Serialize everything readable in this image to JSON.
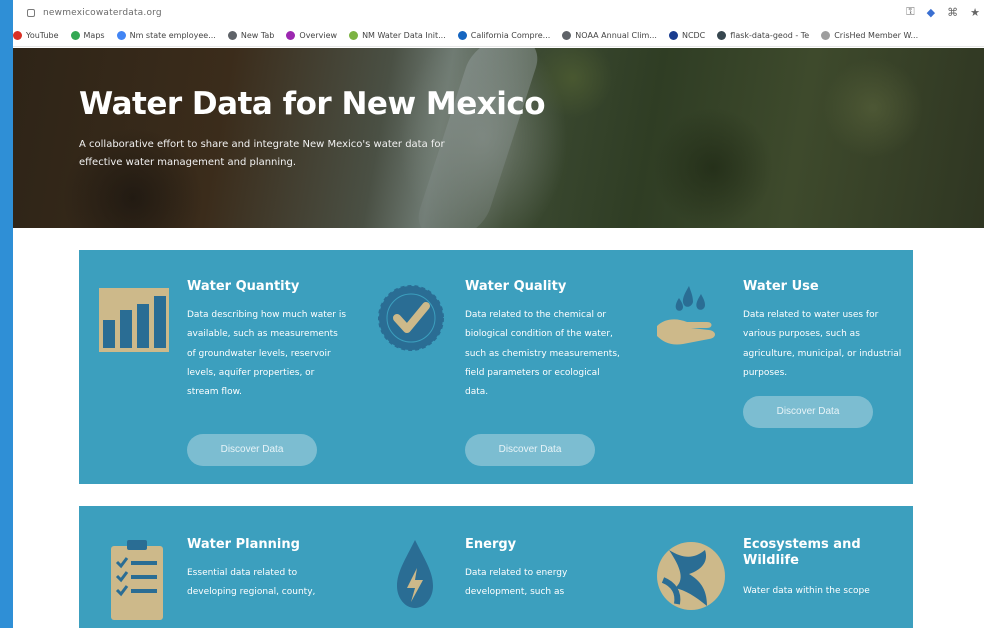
{
  "browser": {
    "url": "newmexicowaterdata.org",
    "bookmarks": [
      {
        "label": "YouTube",
        "color": "#d93025"
      },
      {
        "label": "Maps",
        "color": "#34a853"
      },
      {
        "label": "Nm state employee...",
        "color": "#4285f4"
      },
      {
        "label": "New Tab",
        "color": "#5f6368"
      },
      {
        "label": "Overview",
        "color": "#9c27b0"
      },
      {
        "label": "NM Water Data Init...",
        "color": "#7cb342"
      },
      {
        "label": "California Compre...",
        "color": "#1565c0"
      },
      {
        "label": "NOAA Annual Clim...",
        "color": "#5f6368"
      },
      {
        "label": "NCDC",
        "color": "#1a3d8f"
      },
      {
        "label": "flask-data-geod - Te",
        "color": "#37474f"
      },
      {
        "label": "CrisHed Member W...",
        "color": "#9e9e9e"
      }
    ]
  },
  "hero": {
    "title": "Water Data for New Mexico",
    "subtitle": "A collaborative effort to share and integrate New Mexico's water data for effective water management and planning."
  },
  "cards": [
    {
      "title": "Water Quantity",
      "description": "Data describing how much water is available, such as measurements of groundwater levels, reservoir levels, aquifer properties, or stream flow.",
      "button": "Discover Data"
    },
    {
      "title": "Water Quality",
      "description": "Data related to the chemical or biological condition of the water, such as chemistry measurements, field parameters or ecological data.",
      "button": "Discover Data"
    },
    {
      "title": "Water Use",
      "description": "Data related to water uses for various purposes, such as agriculture, municipal, or industrial purposes.",
      "button": "Discover Data"
    },
    {
      "title": "Water Planning",
      "description": "Essential data related to developing regional, county,"
    },
    {
      "title": "Energy",
      "description": "Data related to energy development, such as"
    },
    {
      "title": "Ecosystems and Wildlife",
      "description": "Water data within the scope"
    }
  ],
  "colors": {
    "panel": "#3c9fbe",
    "button": "#7cbdd1",
    "icon_tan": "#cdb98a",
    "icon_blue": "#2a6d94"
  }
}
